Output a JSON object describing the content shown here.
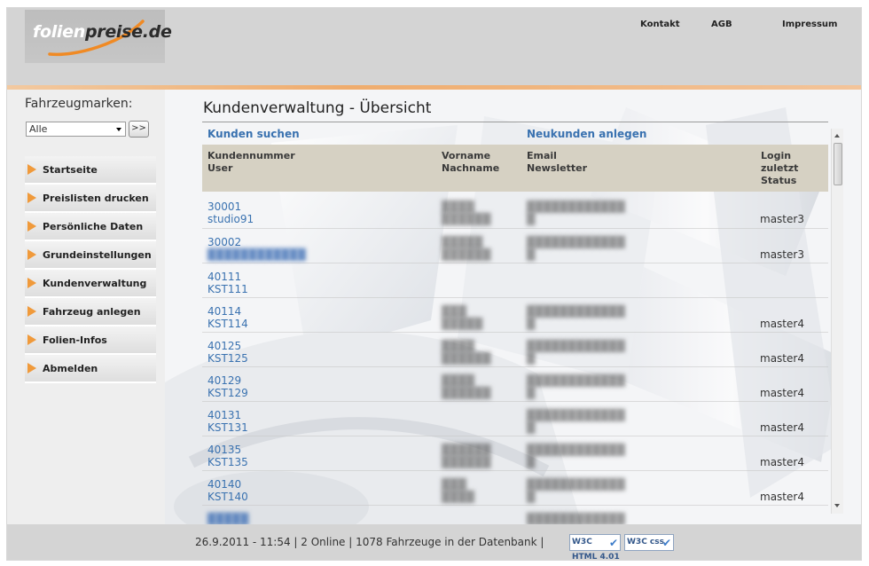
{
  "header": {
    "logo_part1": "folien",
    "logo_part2": "preise.de",
    "nav": [
      "Kontakt",
      "AGB",
      "Impressum"
    ]
  },
  "sidebar": {
    "marken_label": "Fahrzeugmarken:",
    "marken_value": "Alle",
    "go_label": ">>",
    "items": [
      {
        "label": "Startseite"
      },
      {
        "label": "Preislisten drucken"
      },
      {
        "label": "Persönliche Daten"
      },
      {
        "label": "Grundeinstellungen"
      },
      {
        "label": "Kundenverwaltung"
      },
      {
        "label": "Fahrzeug anlegen"
      },
      {
        "label": "Folien-Infos"
      },
      {
        "label": "Abmelden"
      }
    ]
  },
  "main": {
    "title": "Kundenverwaltung - Übersicht",
    "search_link": "Kunden suchen",
    "new_link": "Neukunden anlegen",
    "columns": {
      "col1_l1": "Kundennummer",
      "col1_l2": "User",
      "col2_l1": "Vorname",
      "col2_l2": "Nachname",
      "col3_l1": "Email",
      "col3_l2": "Newsletter",
      "col4_l1": "Login",
      "col4_l2": "zuletzt",
      "col4_l3": "Status"
    },
    "rows": [
      {
        "number": "30001",
        "user": "studio91",
        "status": "master3"
      },
      {
        "number": "30002",
        "user": "",
        "status": "master3"
      },
      {
        "number": "40111",
        "user": "KST111",
        "status": ""
      },
      {
        "number": "40114",
        "user": "KST114",
        "status": "master4"
      },
      {
        "number": "40125",
        "user": "KST125",
        "status": "master4"
      },
      {
        "number": "40129",
        "user": "KST129",
        "status": "master4"
      },
      {
        "number": "40131",
        "user": "KST131",
        "status": "master4"
      },
      {
        "number": "40135",
        "user": "KST135",
        "status": "master4"
      },
      {
        "number": "40140",
        "user": "KST140",
        "status": "master4"
      }
    ]
  },
  "footer": {
    "text": "26.9.2011 - 11:54 | 2 Online | 1078 Fahrzeuge in der Datenbank |",
    "badge_html": "W3C HTML 4.01",
    "badge_css": "W3C css"
  },
  "colors": {
    "accent_orange": "#f09a3b",
    "link_blue": "#3a72b0",
    "table_header": "#d6d1c3"
  }
}
